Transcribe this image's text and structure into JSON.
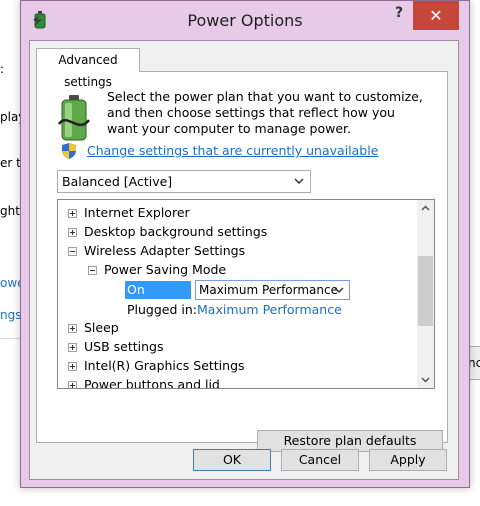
{
  "background": {
    "fragments": [
      ":",
      "play",
      "er t",
      "ght",
      "owe",
      "ngs"
    ],
    "right_fragment": "nc"
  },
  "window": {
    "title": "Power Options",
    "help_glyph": "?",
    "close_glyph": "✕"
  },
  "tab": {
    "label": "Advanced settings"
  },
  "description": "Select the power plan that you want to customize, and then choose settings that reflect how you want your computer to manage power.",
  "change_link": "Change settings that are currently unavailable",
  "plan_select": {
    "value": "Balanced [Active]"
  },
  "tree": {
    "items": [
      {
        "label": "Internet Explorer",
        "state": "collapsed"
      },
      {
        "label": "Desktop background settings",
        "state": "collapsed"
      },
      {
        "label": "Wireless Adapter Settings",
        "state": "expanded"
      },
      {
        "label": "Power Saving Mode",
        "state": "expanded"
      },
      {
        "label": "Sleep",
        "state": "collapsed"
      },
      {
        "label": "USB settings",
        "state": "collapsed"
      },
      {
        "label": "Intel(R) Graphics Settings",
        "state": "collapsed"
      },
      {
        "label": "Power buttons and lid",
        "state": "collapsed"
      }
    ],
    "on_battery": {
      "label": "On battery:",
      "value": "Maximum Performance"
    },
    "plugged_in": {
      "label": "Plugged in:",
      "value": "Maximum Performance"
    }
  },
  "buttons": {
    "restore": "Restore plan defaults",
    "ok": "OK",
    "cancel": "Cancel",
    "apply": "Apply"
  },
  "colors": {
    "frame": "#e7c9e8",
    "close": "#c7463c",
    "link": "#1a6fc9",
    "selection": "#3399ff"
  }
}
